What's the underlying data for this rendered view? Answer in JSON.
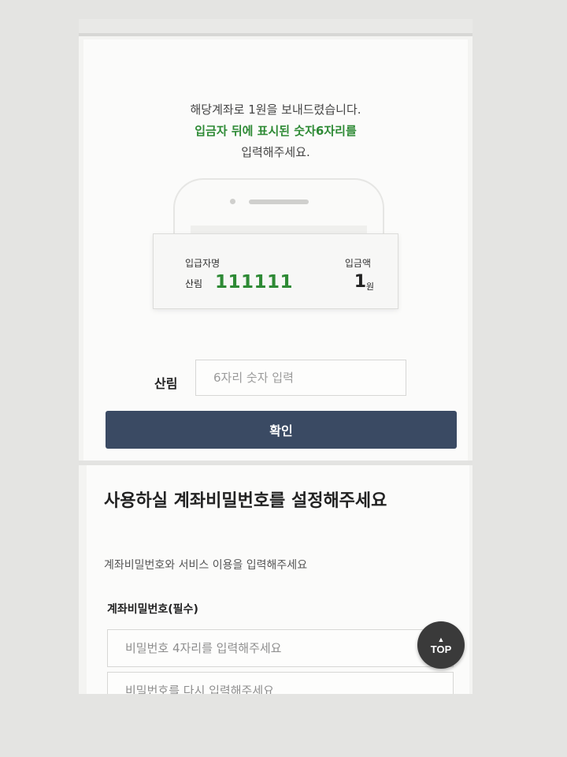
{
  "verify": {
    "message_line1": "해당계좌로 1원을 보내드렸습니다.",
    "message_line2": "입금자 뒤에 표시된 숫자6자리를",
    "message_line3": "입력해주세요.",
    "deposit_name_label": "입급자명",
    "deposit_amount_label": "입금액",
    "deposit_name": "산림",
    "deposit_code": "111111",
    "deposit_amount": "1",
    "deposit_unit": "원",
    "input_prefix": "산림",
    "input_placeholder": "6자리 숫자 입력",
    "confirm_label": "확인"
  },
  "password": {
    "title": "사용하실 계좌비밀번호를 설정해주세요",
    "subtitle": "계좌비밀번호와 서비스 이용을 입력해주세요",
    "label": "계좌비밀번호(필수)",
    "placeholder1": "비밀번호 4자리를 입력해주세요",
    "placeholder2": "비밀번호를 다시 입력해주세요"
  },
  "top_button": {
    "label": "TOP",
    "icon": "triangle-up-icon"
  },
  "colors": {
    "accent_green": "#2e8a35",
    "button_navy": "#3a4a63"
  }
}
